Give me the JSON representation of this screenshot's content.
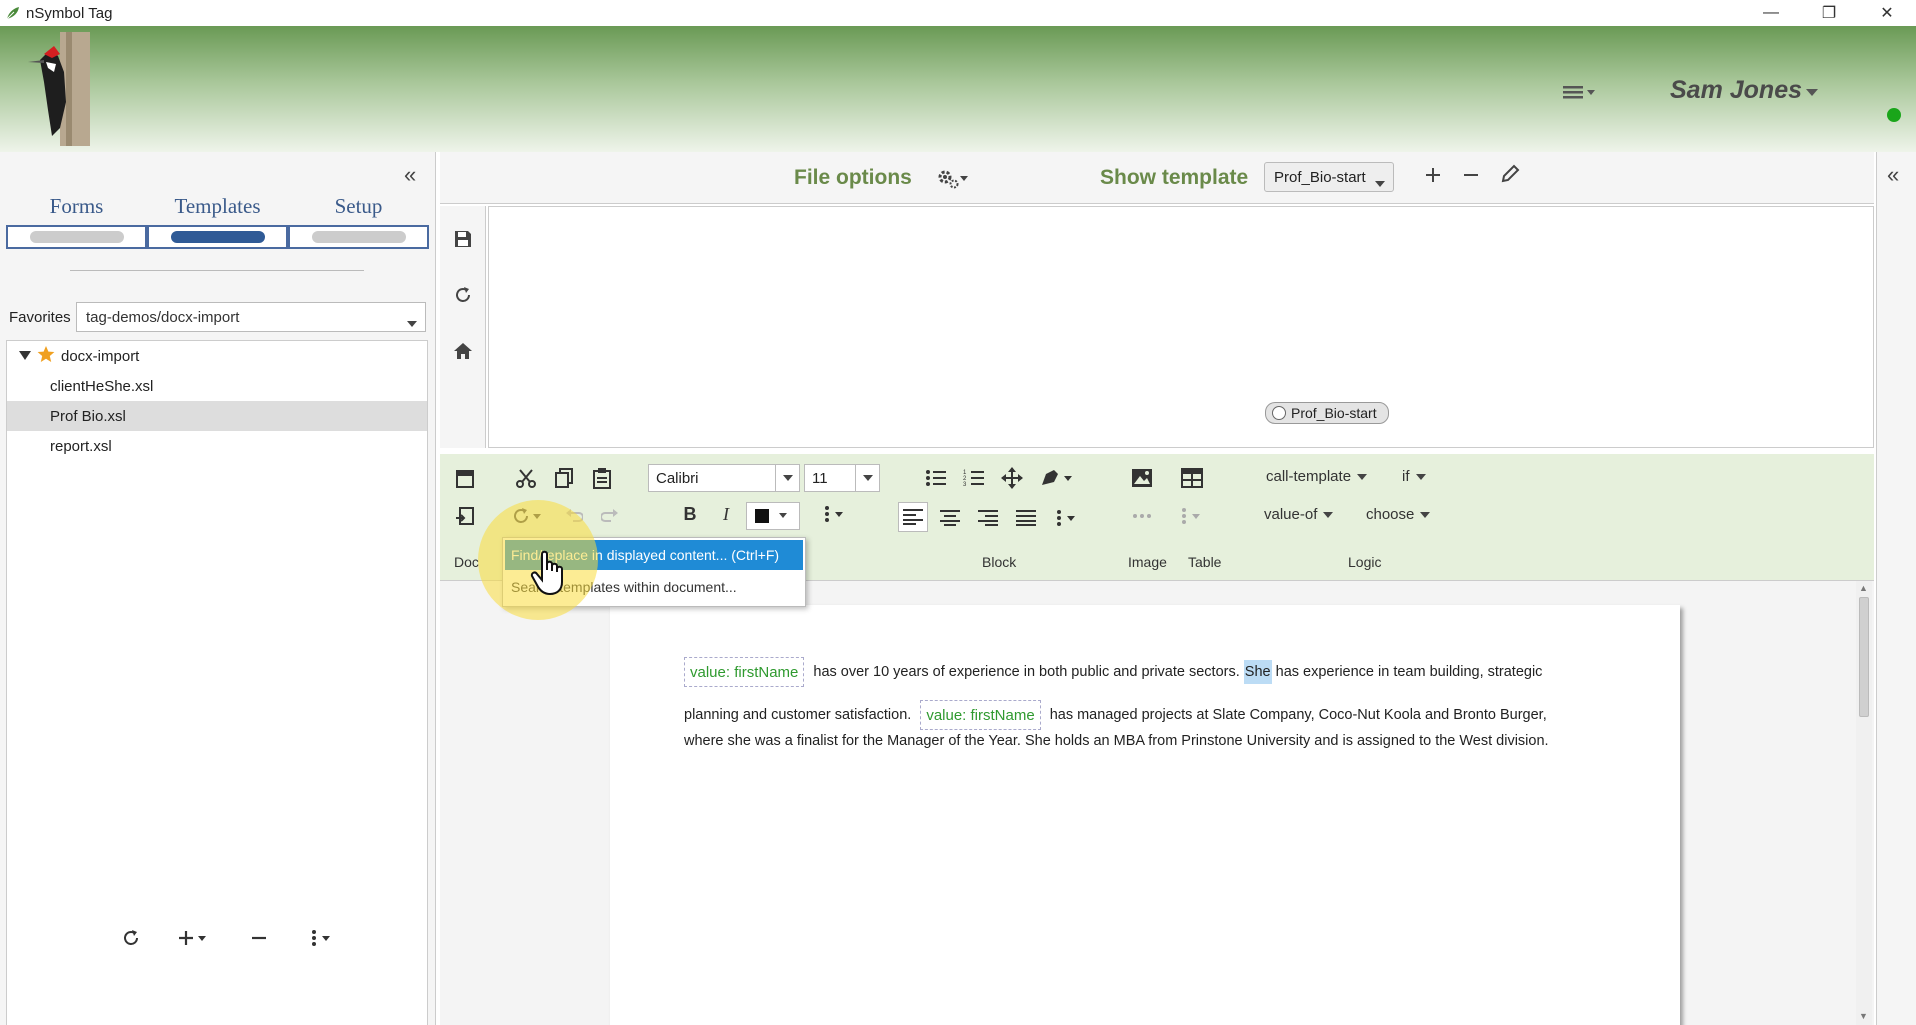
{
  "window": {
    "title": "nSymbol Tag",
    "icon": "leaf-icon",
    "controls": {
      "minimize": "—",
      "maximize": "❐",
      "close": "✕"
    }
  },
  "header": {
    "logo": "woodpecker-logo",
    "user_name": "Sam Jones",
    "status_color": "#1aa51a"
  },
  "left_panel": {
    "collapse": "«",
    "tabs": [
      {
        "label": "Forms",
        "active": false
      },
      {
        "label": "Templates",
        "active": true
      },
      {
        "label": "Setup",
        "active": false
      }
    ],
    "favorites": {
      "label": "Favorites",
      "value": "tag-demos/docx-import"
    },
    "tree": {
      "root": "docx-import",
      "children": [
        "clientHeShe.xsl",
        "Prof Bio.xsl",
        "report.xsl"
      ],
      "selected": "Prof Bio.xsl"
    }
  },
  "file_options": {
    "label": "File options",
    "show_template_label": "Show template",
    "template_value": "Prof_Bio-start"
  },
  "template_canvas": {
    "node_label": "Prof_Bio-start"
  },
  "ribbon": {
    "font": "Calibri",
    "size": "11",
    "groups": {
      "doc": "Doc",
      "block": "Block",
      "image": "Image",
      "table": "Table",
      "logic": "Logic"
    },
    "logic": {
      "call_template": "call-template",
      "if": "if",
      "value_of": "value-of",
      "choose": "choose"
    },
    "bold": "B",
    "italic": "I"
  },
  "popup_menu": {
    "items": [
      {
        "label": "Find/replace in displayed content... (Ctrl+F)",
        "highlighted": true
      },
      {
        "label": "Search templates within document...",
        "highlighted": false
      }
    ]
  },
  "document": {
    "line1": {
      "chip": "value: firstName",
      "text_before": "has over 10 years of experience in both public and private sectors.",
      "highlight": "She",
      "text_after": "has experience in team building, strategic"
    },
    "line2": {
      "text_before": "planning and customer satisfaction.",
      "chip": "value: firstName",
      "text_after": "has managed projects at Slate Company, Coco-Nut Koola and Bronto Burger,"
    },
    "line3": {
      "text": "where she was a finalist for the Manager of the Year. She holds an MBA from Prinstone University and is assigned to the West division."
    }
  }
}
